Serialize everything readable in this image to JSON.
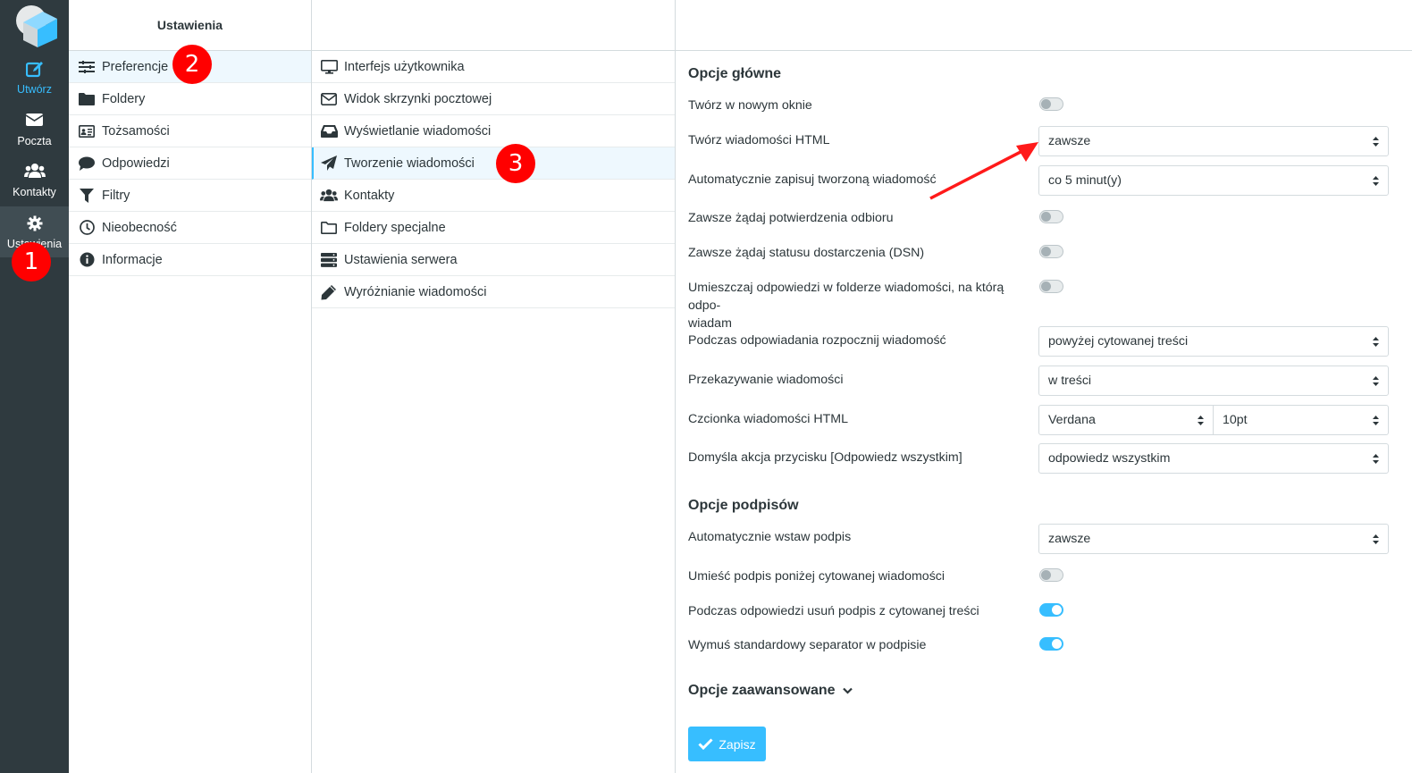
{
  "nav": {
    "compose": "Utwórz",
    "mail": "Poczta",
    "contacts": "Kontakty",
    "settings": "Ustawienia"
  },
  "settings_column": {
    "title": "Ustawienia",
    "items": [
      "Preferencje",
      "Foldery",
      "Tożsamości",
      "Odpowiedzi",
      "Filtry",
      "Nieobecność",
      "Informacje"
    ]
  },
  "preferences_column": {
    "items": [
      "Interfejs użytkownika",
      "Widok skrzynki pocztowej",
      "Wyświetlanie wiadomości",
      "Tworzenie wiadomości",
      "Kontakty",
      "Foldery specjalne",
      "Ustawienia serwera",
      "Wyróżnianie wiadomości"
    ]
  },
  "form": {
    "main_title": "Opcje główne",
    "new_window": {
      "label": "Twórz w nowym oknie",
      "on": false
    },
    "html_compose": {
      "label": "Twórz wiadomości HTML",
      "value": "zawsze"
    },
    "autosave": {
      "label": "Automatycznie zapisuj tworzoną wiadomość",
      "value": "co 5 minut(y)"
    },
    "mdn": {
      "label": "Zawsze żądaj potwierdzenia odbioru",
      "on": false
    },
    "dsn": {
      "label": "Zawsze żądaj statusu dostarczenia (DSN)",
      "on": false
    },
    "reply_same_folder": {
      "label_line1": "Umieszczaj odpowiedzi w folderze wiadomości, na którą odpo-",
      "label_line2": "wiadam",
      "on": false
    },
    "reply_mode": {
      "label": "Podczas odpowiadania rozpocznij wiadomość",
      "value": "powyżej cytowanej treści"
    },
    "forward": {
      "label": "Przekazywanie wiadomości",
      "value": "w treści"
    },
    "font": {
      "label": "Czcionka wiadomości HTML",
      "family": "Verdana",
      "size": "10pt"
    },
    "reply_all": {
      "label": "Domyśla akcja przycisku [Odpowiedz wszystkim]",
      "value": "odpowiedz wszystkim"
    },
    "sig_title": "Opcje podpisów",
    "auto_sig": {
      "label": "Automatycznie wstaw podpis",
      "value": "zawsze"
    },
    "sig_below": {
      "label": "Umieść podpis poniżej cytowanej wiadomości",
      "on": false
    },
    "strip_sig": {
      "label": "Podczas odpowiedzi usuń podpis z cytowanej treści",
      "on": true
    },
    "force_sep": {
      "label": "Wymuś standardowy separator w podpisie",
      "on": true
    },
    "advanced_title": "Opcje zaawansowane",
    "save": "Zapisz"
  },
  "annotations": {
    "b1": "1",
    "b2": "2",
    "b3": "3"
  },
  "colors": {
    "accent": "#37beff",
    "nav_bg": "#2f3a3f",
    "badge": "#ff0000"
  }
}
